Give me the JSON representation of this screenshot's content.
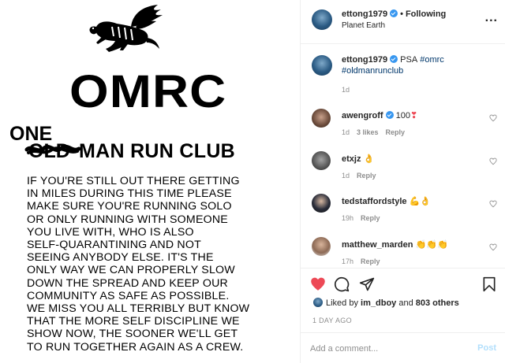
{
  "post_image": {
    "logo": "OMRC",
    "one_word": "ONE",
    "old_word": "OLD",
    "club_name": "MAN RUN CLUB",
    "psa_text": "IF YOU'RE STILL OUT THERE GETTING\nIN MILES DURING THIS TIME PLEASE\nMAKE SURE YOU'RE RUNNING SOLO\nOR ONLY RUNNING WITH SOMEONE\nYOU LIVE WITH, WHO IS ALSO\nSELF-QUARANTINING AND NOT\nSEEING ANYBODY ELSE. IT'S THE\nONLY WAY WE CAN PROPERLY SLOW\nDOWN THE SPREAD AND KEEP OUR\nCOMMUNITY AS SAFE AS POSSIBLE.\nWE MISS YOU ALL TERRIBLY BUT KNOW\nTHAT THE MORE SELF DISCIPLINE WE\nSHOW NOW, THE SOONER WE'LL GET\nTO RUN TOGETHER AGAIN AS A CREW."
  },
  "header": {
    "username": "ettong1979",
    "dot": "•",
    "follow_status": "Following",
    "location": "Planet Earth",
    "more_icon": "more-options-icon",
    "more_label": "..."
  },
  "caption": {
    "username": "ettong1979",
    "text": "PSA",
    "tag1": "#omrc",
    "tag2": "#oldmanrunclub",
    "time": "1d"
  },
  "comments": [
    {
      "username": "awengroff",
      "verified": true,
      "text": "100",
      "emoji": "❣",
      "time": "1d",
      "likes": "3 likes",
      "reply": "Reply"
    },
    {
      "username": "etxjz",
      "text": "",
      "emoji": "👌",
      "time": "1d",
      "reply": "Reply"
    },
    {
      "username": "tedstaffordstyle",
      "text": "",
      "emoji": "💪👌",
      "time": "19h",
      "reply": "Reply"
    },
    {
      "username": "matthew_marden",
      "text": "",
      "emoji": "👏👏👏",
      "time": "17h",
      "reply": "Reply"
    }
  ],
  "actions": {
    "liked_by_prefix": "Liked by",
    "liked_by_user": "im_dboy",
    "liked_by_and": "and",
    "others": "803 others",
    "date": "1 DAY AGO"
  },
  "comment_box": {
    "placeholder": "Add a comment...",
    "post_label": "Post"
  },
  "colors": {
    "heart_red": "#ed4956",
    "link_blue": "#00376b",
    "verified_blue": "#3897f0",
    "post_disabled": "#b2dffc"
  }
}
